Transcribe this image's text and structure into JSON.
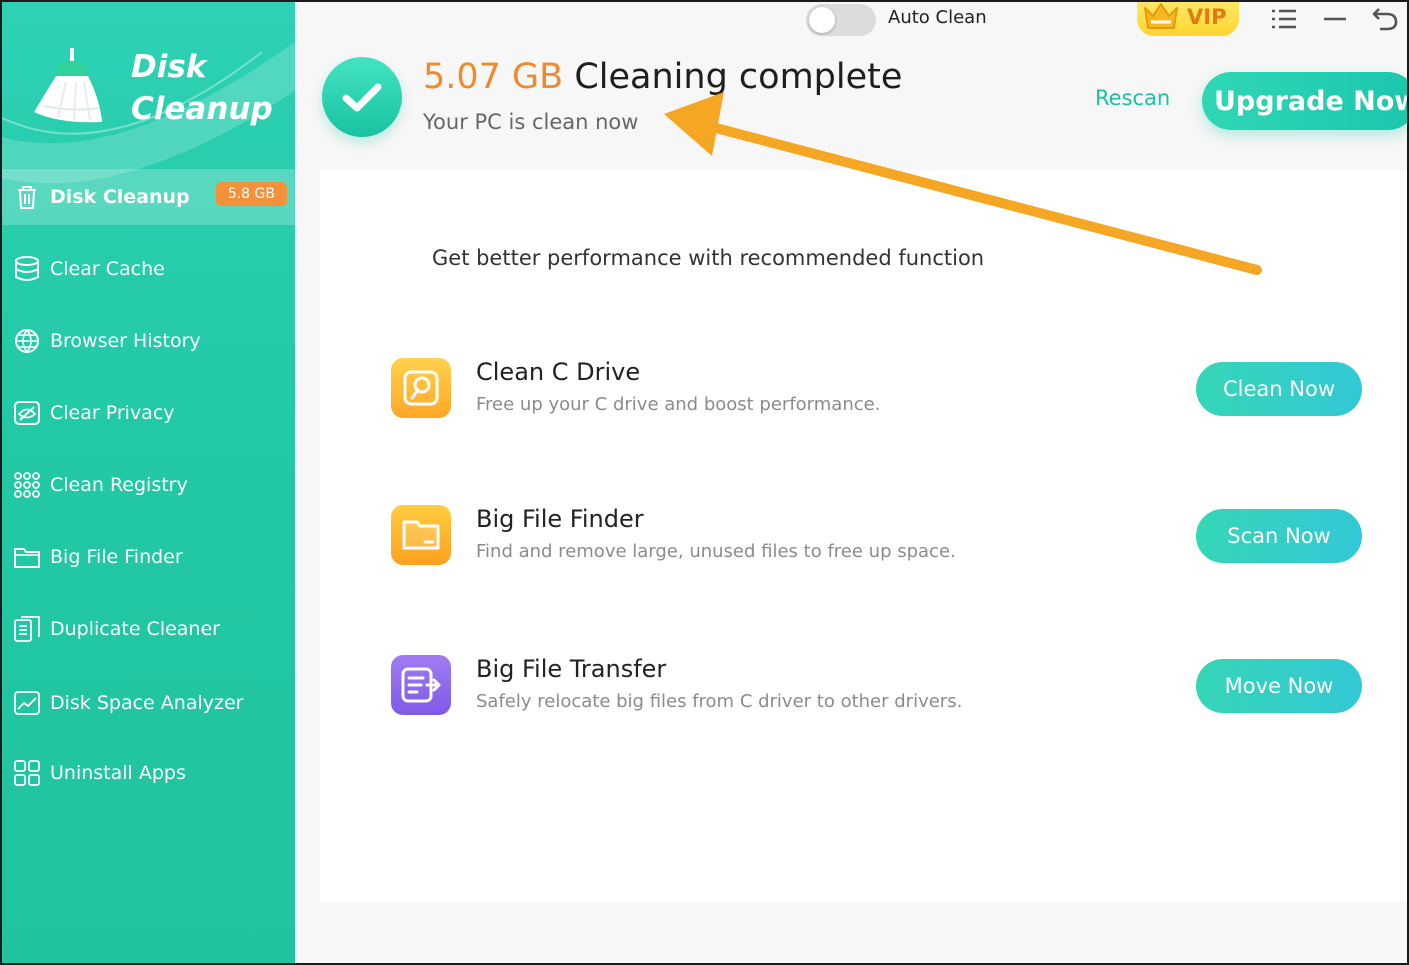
{
  "app": {
    "logo_line1": "Disk",
    "logo_line2": "Cleanup"
  },
  "sidebar": {
    "items": [
      {
        "label": "Disk Cleanup",
        "icon": "trash-icon",
        "badge": "5.8 GB",
        "active": true
      },
      {
        "label": "Clear Cache",
        "icon": "database-icon"
      },
      {
        "label": "Browser History",
        "icon": "globe-icon"
      },
      {
        "label": "Clear Privacy",
        "icon": "eye-off-icon"
      },
      {
        "label": "Clean Registry",
        "icon": "grid-dots-icon"
      },
      {
        "label": "Big File Finder",
        "icon": "folder-icon"
      },
      {
        "label": "Duplicate Cleaner",
        "icon": "duplicate-icon"
      },
      {
        "label": "Disk Space Analyzer",
        "icon": "chart-icon"
      },
      {
        "label": "Uninstall Apps",
        "icon": "apps-icon"
      }
    ]
  },
  "topbar": {
    "auto_clean_label": "Auto Clean",
    "auto_clean_on": false,
    "vip_label": "VIP"
  },
  "header": {
    "size": "5.07 GB",
    "title": "Cleaning complete",
    "subtitle": "Your PC is clean now",
    "rescan_label": "Rescan",
    "upgrade_label": "Upgrade Now"
  },
  "main": {
    "heading": "Get better performance with recommended function",
    "features": [
      {
        "title": "Clean C Drive",
        "desc": "Free up your C drive and boost performance.",
        "button": "Clean Now",
        "icon": "drive-icon"
      },
      {
        "title": "Big File Finder",
        "desc": "Find and remove large, unused files to free up space.",
        "button": "Scan Now",
        "icon": "folder-icon"
      },
      {
        "title": "Big File Transfer",
        "desc": "Safely relocate big files from C driver to other drivers.",
        "button": "Move Now",
        "icon": "file-transfer-icon"
      }
    ]
  },
  "colors": {
    "accent": "#22c9a5",
    "orange": "#f08a2e",
    "annotation_arrow": "#f5a623"
  }
}
